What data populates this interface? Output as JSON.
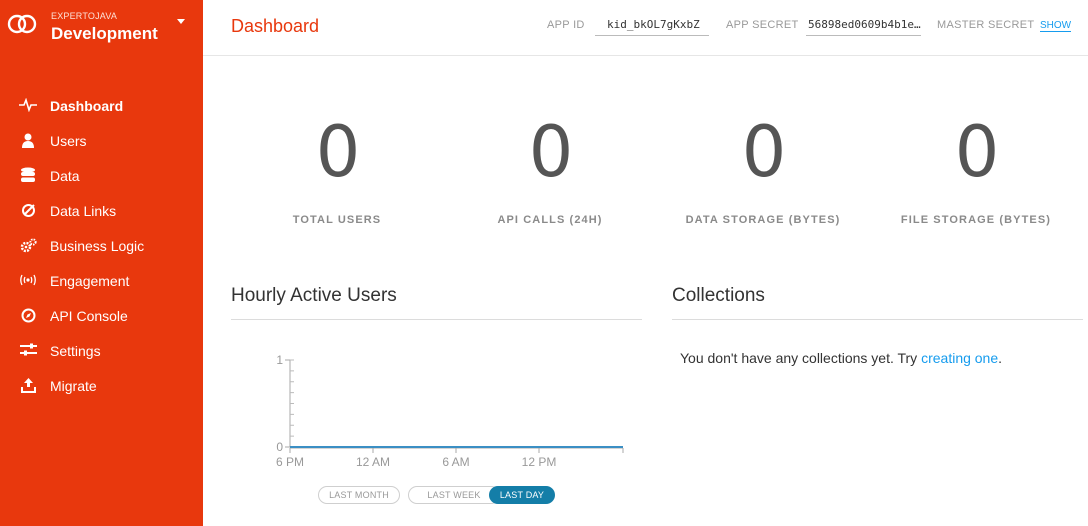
{
  "colors": {
    "sidebar": "#e8380d",
    "accent_title": "#e8380d",
    "link": "#169cee",
    "active_range": "#147ea8"
  },
  "app": {
    "org": "EXPERTOJAVA",
    "name": "Development"
  },
  "nav": [
    {
      "label": "Dashboard",
      "icon": "pulse-icon",
      "active": true
    },
    {
      "label": "Users",
      "icon": "user-icon"
    },
    {
      "label": "Data",
      "icon": "database-icon"
    },
    {
      "label": "Data Links",
      "icon": "link-icon"
    },
    {
      "label": "Business Logic",
      "icon": "gears-icon"
    },
    {
      "label": "Engagement",
      "icon": "broadcast-icon"
    },
    {
      "label": "API Console",
      "icon": "compass-icon"
    },
    {
      "label": "Settings",
      "icon": "sliders-icon"
    },
    {
      "label": "Migrate",
      "icon": "upload-icon"
    }
  ],
  "header": {
    "title": "Dashboard",
    "app_id_label": "APP ID",
    "app_id": "kid_bkOL7gKxbZ",
    "app_secret_label": "APP SECRET",
    "app_secret": "56898ed0609b4b1e…",
    "master_secret_label": "MASTER SECRET",
    "show_label": "SHOW"
  },
  "stats": [
    {
      "value": "0",
      "label": "TOTAL USERS"
    },
    {
      "value": "0",
      "label": "API CALLS (24H)"
    },
    {
      "value": "0",
      "label": "DATA STORAGE (BYTES)"
    },
    {
      "value": "0",
      "label": "FILE STORAGE (BYTES)"
    }
  ],
  "hourly": {
    "title": "Hourly Active Users",
    "ranges": [
      "LAST MONTH",
      "LAST WEEK",
      "LAST DAY"
    ],
    "active_range": "LAST DAY"
  },
  "collections": {
    "title": "Collections",
    "empty_text": "You don't have any collections yet. Try ",
    "link_text": "creating one",
    "suffix": "."
  },
  "chart_data": {
    "type": "line",
    "title": "",
    "xlabel": "",
    "ylabel": "",
    "x": [
      "6 PM",
      "12 AM",
      "6 AM",
      "12 PM"
    ],
    "series": [
      {
        "values": [
          0,
          0,
          0,
          0
        ]
      }
    ],
    "y_ticks": [
      "0",
      "1"
    ],
    "ylim": [
      0,
      1
    ],
    "grid": false
  }
}
